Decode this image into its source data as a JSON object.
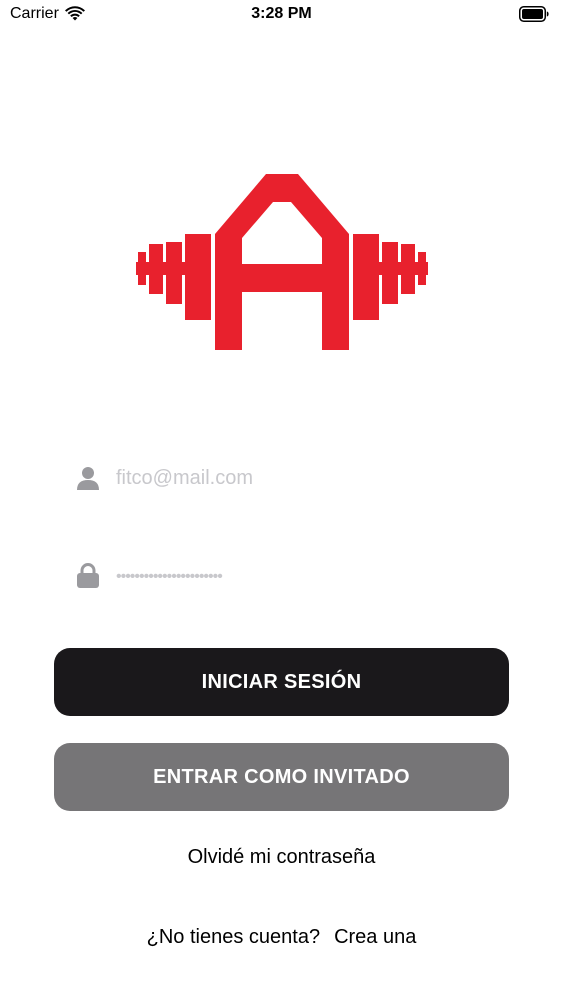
{
  "status_bar": {
    "carrier": "Carrier",
    "time": "3:28 PM",
    "wifi_icon": "wifi-icon",
    "battery_icon": "battery-icon"
  },
  "logo": {
    "icon": "barbell-a-logo",
    "color": "#e8212d"
  },
  "login_form": {
    "email": {
      "icon": "user-icon",
      "placeholder": "fitco@mail.com",
      "value": ""
    },
    "password": {
      "icon": "lock-icon",
      "placeholder": "•••••••••••••••••••••••",
      "value": ""
    }
  },
  "buttons": {
    "login_label": "INICIAR SESIÓN",
    "login_color": "#1a181b",
    "guest_label": "ENTRAR COMO INVITADO",
    "guest_color": "#767577"
  },
  "links": {
    "forgot_password": "Olvidé mi contraseña",
    "no_account": "¿No tienes cuenta?",
    "create_account": "Crea una"
  }
}
